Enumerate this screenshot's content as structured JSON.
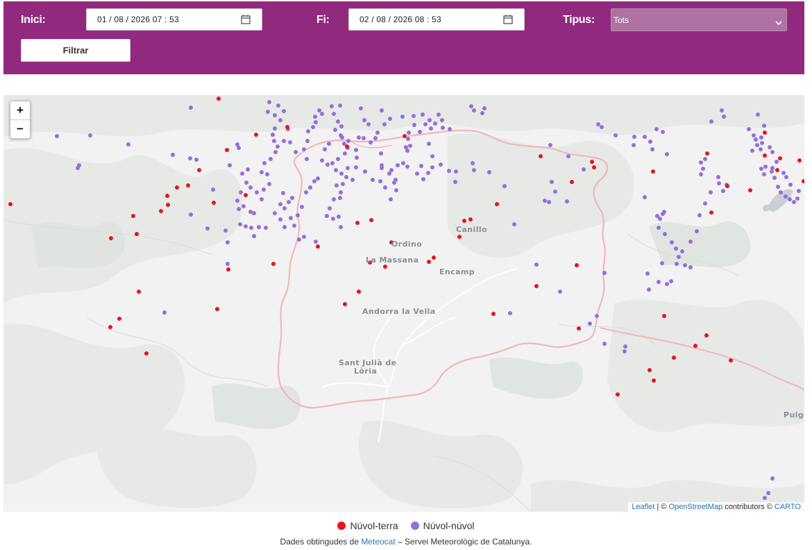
{
  "filters": {
    "start_label": "Inici:",
    "start_value": "01 / 08 / 2026   07 : 53",
    "end_label": "Fi:",
    "end_value": "02 / 08 / 2026   08 : 53",
    "type_label": "Tipus:",
    "type_value": "Tots",
    "filter_button": "Filtrar"
  },
  "map": {
    "zoom_in": "+",
    "zoom_out": "−",
    "places": [
      "Ordino",
      "La Massana",
      "Canillo",
      "Encamp",
      "Andorra la Vella",
      "Sant Julià de",
      "Lòria",
      "Puigc"
    ],
    "attribution": {
      "leaflet": "Leaflet",
      "sep": " | © ",
      "osm": "OpenStreetMap",
      "contributors": " contributors © ",
      "carto": "CARTO"
    }
  },
  "legend": {
    "cloud_ground": "Núvol-terra",
    "cloud_cloud": "Núvol-núvol"
  },
  "colors": {
    "header": "#912a7e",
    "cloud_ground": "#e8141a",
    "cloud_cloud": "#9370db"
  },
  "source": {
    "prefix": "Dades obtingudes de ",
    "link": "Meteocat",
    "suffix": " – Servei Meteorològic de Catalunya."
  }
}
